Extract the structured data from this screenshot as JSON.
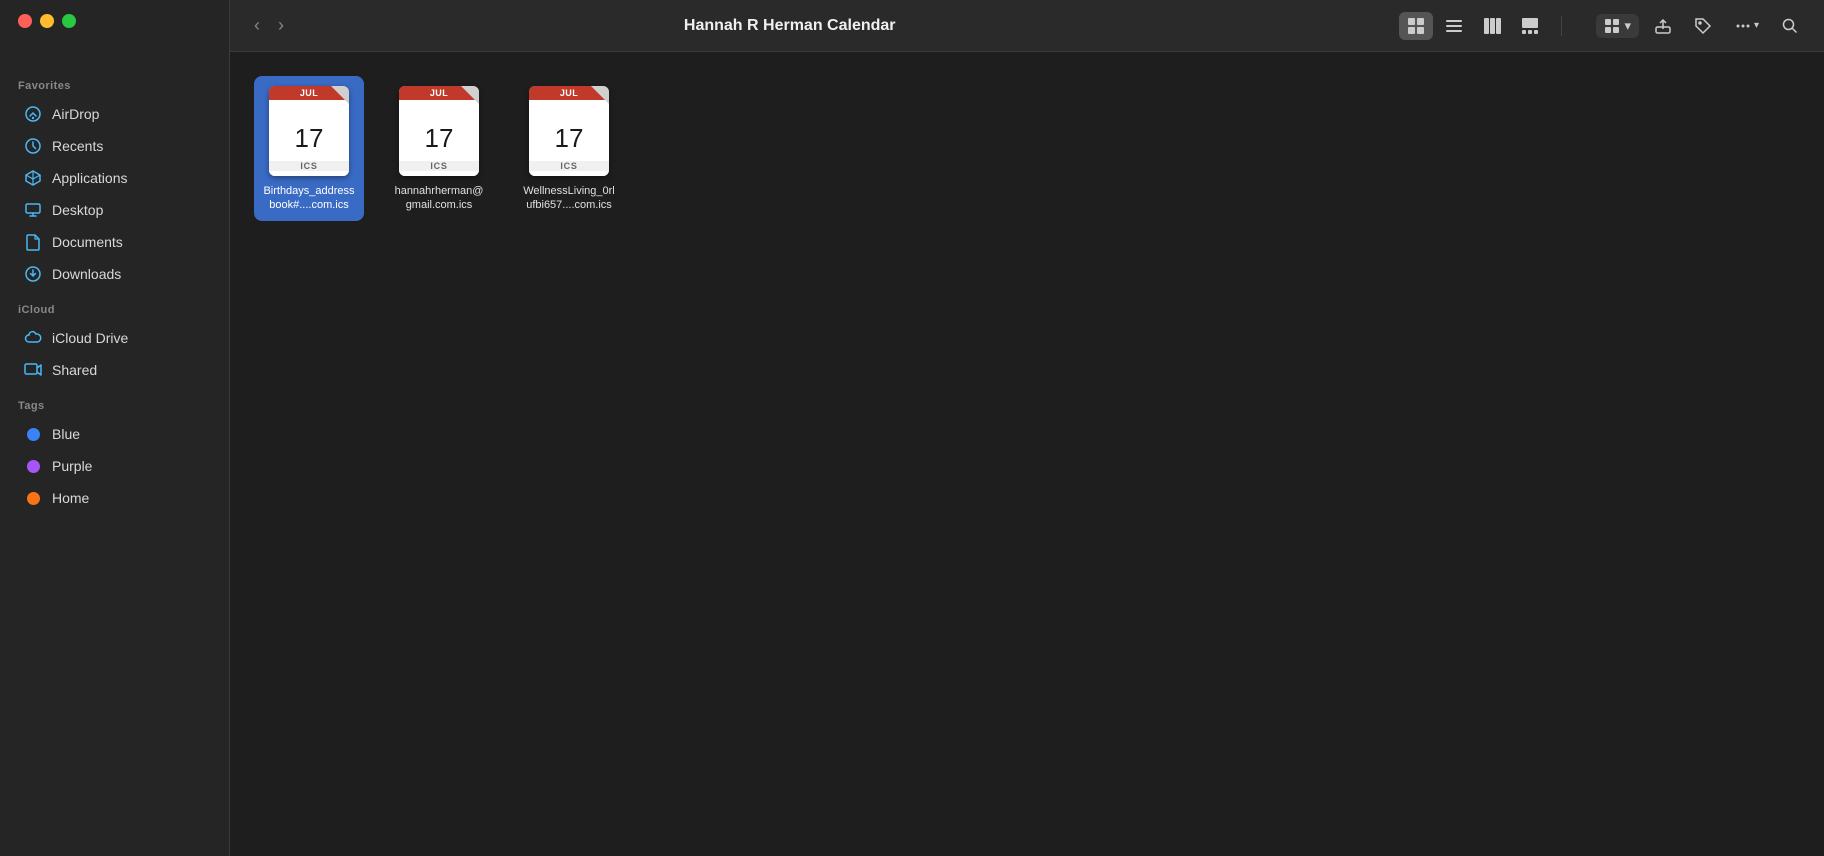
{
  "window": {
    "title": "Hannah R Herman Calendar",
    "traffic": {
      "close": "close",
      "minimize": "minimize",
      "maximize": "maximize"
    }
  },
  "toolbar": {
    "back_label": "‹",
    "forward_label": "›",
    "title": "Hannah R Herman Calendar",
    "views": [
      {
        "id": "grid",
        "label": "⊞",
        "active": true
      },
      {
        "id": "list",
        "label": "☰",
        "active": false
      },
      {
        "id": "columns",
        "label": "⦿",
        "active": false
      },
      {
        "id": "gallery",
        "label": "▦",
        "active": false
      }
    ],
    "group_label": "⊞",
    "share_label": "↑",
    "tag_label": "◇",
    "more_label": "···",
    "search_label": "⌕"
  },
  "sidebar": {
    "sections": [
      {
        "label": "Favorites",
        "items": [
          {
            "id": "airdrop",
            "label": "AirDrop",
            "icon": "airdrop"
          },
          {
            "id": "recents",
            "label": "Recents",
            "icon": "recents"
          },
          {
            "id": "applications",
            "label": "Applications",
            "icon": "applications"
          },
          {
            "id": "desktop",
            "label": "Desktop",
            "icon": "desktop"
          },
          {
            "id": "documents",
            "label": "Documents",
            "icon": "documents"
          },
          {
            "id": "downloads",
            "label": "Downloads",
            "icon": "downloads"
          }
        ]
      },
      {
        "label": "iCloud",
        "items": [
          {
            "id": "icloud-drive",
            "label": "iCloud Drive",
            "icon": "icloud"
          },
          {
            "id": "shared",
            "label": "Shared",
            "icon": "shared"
          }
        ]
      },
      {
        "label": "Tags",
        "items": [
          {
            "id": "blue",
            "label": "Blue",
            "color": "#3b82f6"
          },
          {
            "id": "purple",
            "label": "Purple",
            "color": "#a855f7"
          },
          {
            "id": "home",
            "label": "Home",
            "color": "#f97316"
          }
        ]
      }
    ]
  },
  "files": [
    {
      "id": "birthdays",
      "name": "Birthdays_addressbook#....com.ics",
      "month": "JUL",
      "day": "17",
      "ext": "ICS",
      "selected": true
    },
    {
      "id": "gmail",
      "name": "hannahrherman@gmail.com.ics",
      "month": "JUL",
      "day": "17",
      "ext": "ICS",
      "selected": false
    },
    {
      "id": "wellness",
      "name": "WellnessLiving_0rlufbi657....com.ics",
      "month": "JUL",
      "day": "17",
      "ext": "ICS",
      "selected": false
    }
  ]
}
